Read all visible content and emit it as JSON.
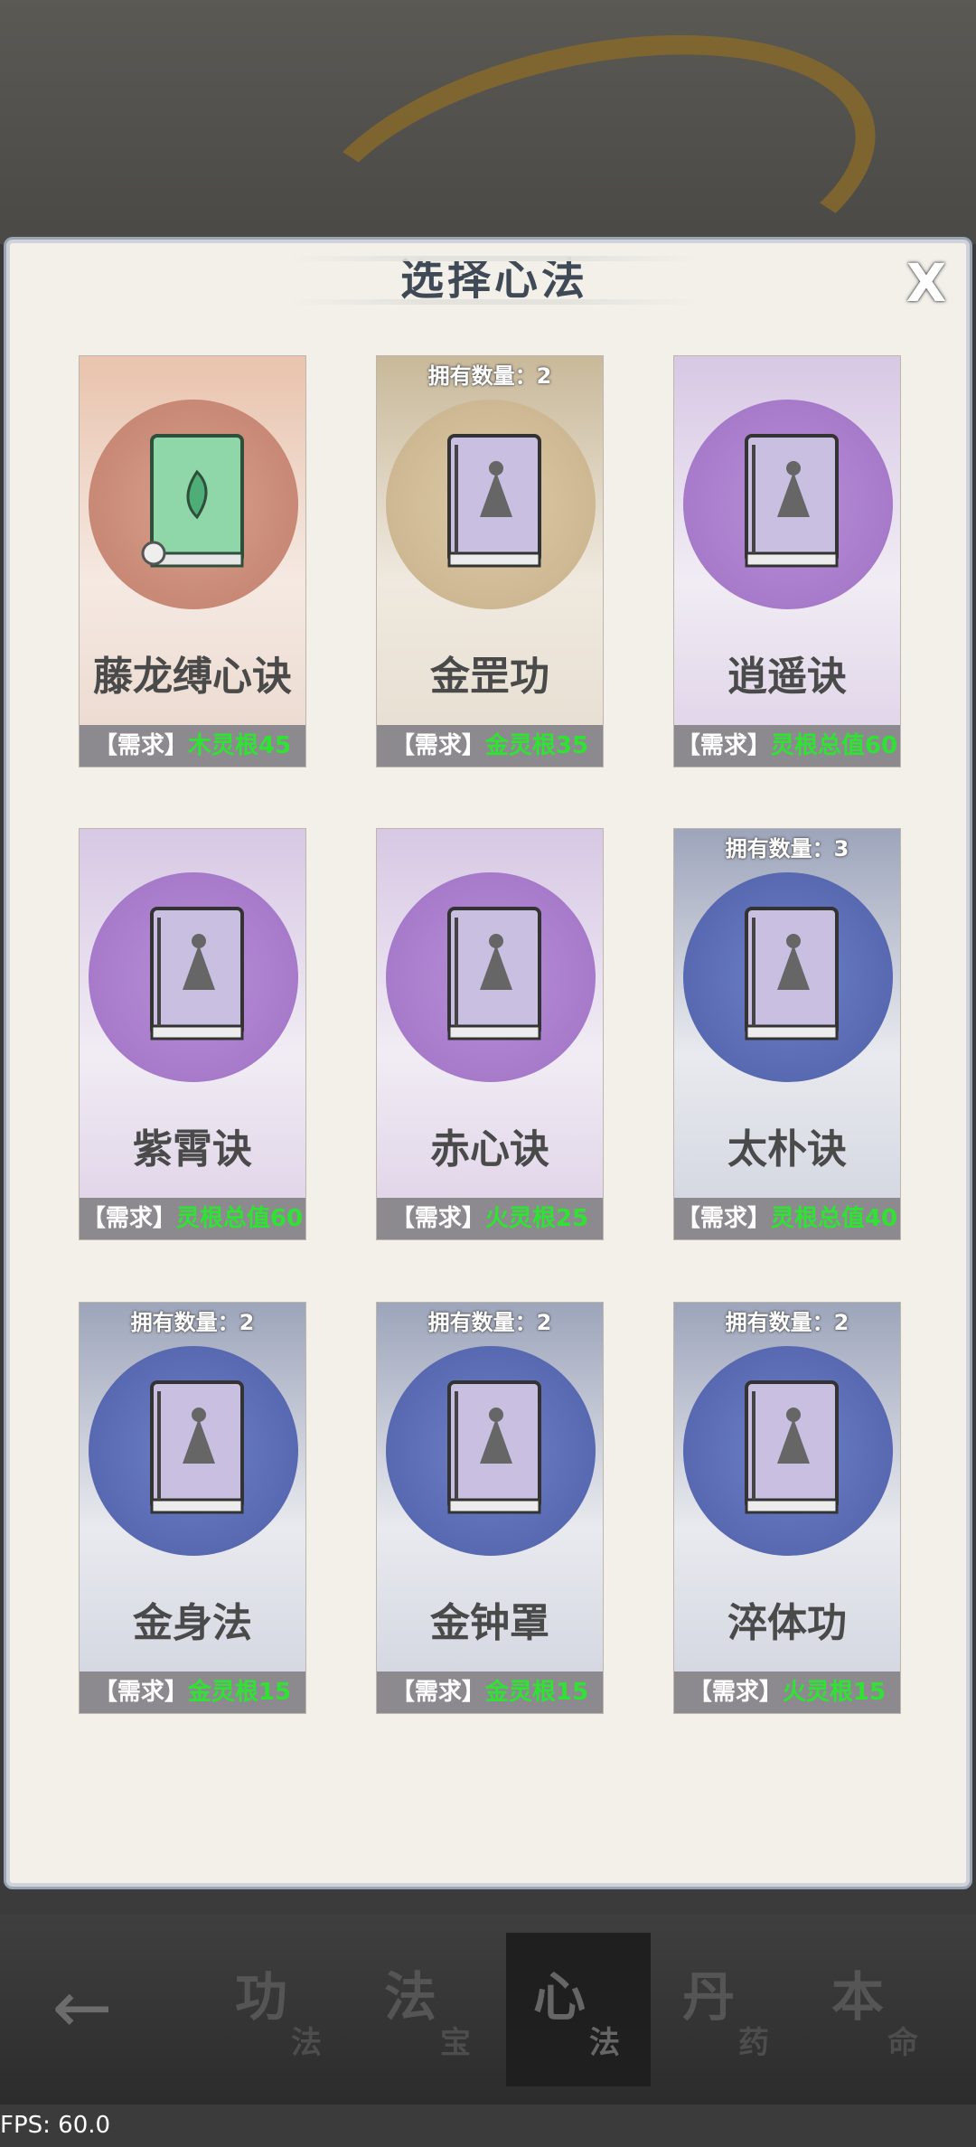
{
  "dialog": {
    "title": "选择心法",
    "close_label": "X"
  },
  "cards": [
    {
      "name": "藤龙缚心诀",
      "owned": "",
      "req_label": "【需求】",
      "req_value": "木灵根45",
      "theme": "orange",
      "icon": "green-book-icon"
    },
    {
      "name": "金罡功",
      "owned": "拥有数量：2",
      "req_label": "【需求】",
      "req_value": "金灵根35",
      "theme": "gold",
      "icon": "gold-book-icon"
    },
    {
      "name": "逍遥诀",
      "owned": "",
      "req_label": "【需求】",
      "req_value": "灵根总值60",
      "theme": "purple",
      "icon": "purple-book-icon"
    },
    {
      "name": "紫霄诀",
      "owned": "",
      "req_label": "【需求】",
      "req_value": "灵根总值60",
      "theme": "purple",
      "icon": "purple-book-icon"
    },
    {
      "name": "赤心诀",
      "owned": "",
      "req_label": "【需求】",
      "req_value": "火灵根25",
      "theme": "purple",
      "icon": "purple-book-icon"
    },
    {
      "name": "太朴诀",
      "owned": "拥有数量：3",
      "req_label": "【需求】",
      "req_value": "灵根总值40",
      "theme": "blue",
      "icon": "blue-book-icon"
    },
    {
      "name": "金身法",
      "owned": "拥有数量：2",
      "req_label": "【需求】",
      "req_value": "金灵根15",
      "theme": "blue",
      "icon": "blue-book-icon"
    },
    {
      "name": "金钟罩",
      "owned": "拥有数量：2",
      "req_label": "【需求】",
      "req_value": "金灵根15",
      "theme": "blue",
      "icon": "blue-book-icon"
    },
    {
      "name": "淬体功",
      "owned": "拥有数量：2",
      "req_label": "【需求】",
      "req_value": "火灵根15",
      "theme": "blue",
      "icon": "blue-book-icon"
    }
  ],
  "nav": {
    "back_label": "←",
    "tabs": [
      {
        "big": "功",
        "small": "法"
      },
      {
        "big": "法",
        "small": "宝"
      },
      {
        "big": "心",
        "small": "法"
      },
      {
        "big": "丹",
        "small": "药"
      },
      {
        "big": "本",
        "small": "命"
      }
    ],
    "active_tab": "心法"
  },
  "fps": "FPS: 60.0"
}
